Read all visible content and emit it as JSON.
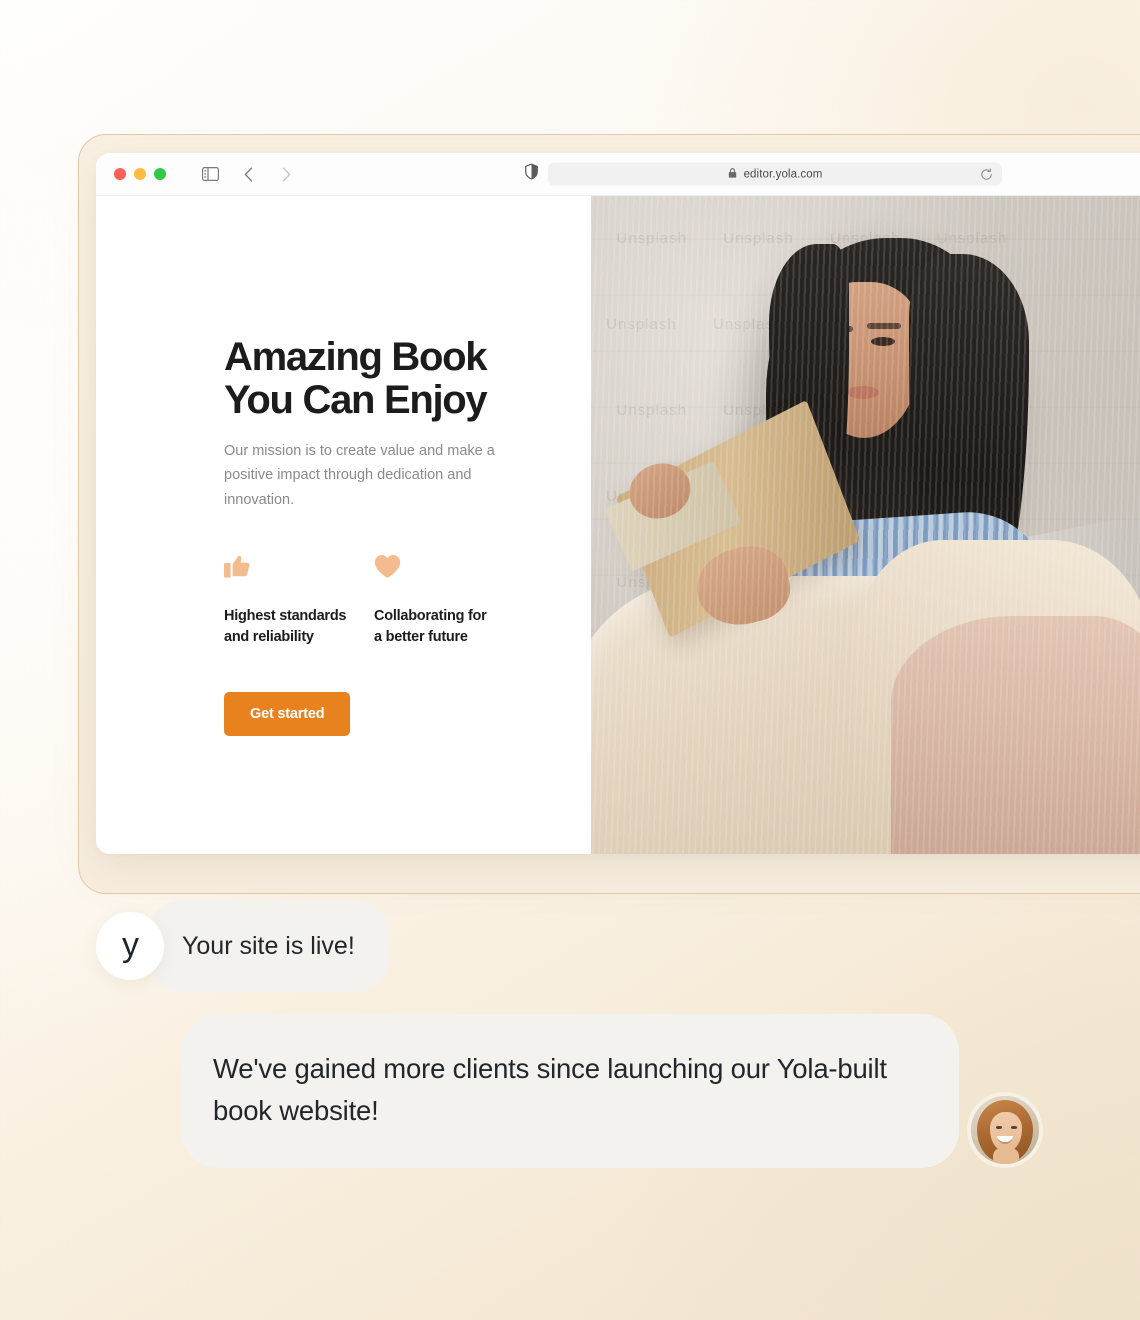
{
  "browser": {
    "traffic_lights": [
      "close",
      "minimize",
      "maximize"
    ],
    "sidebar_icon": "sidebar-toggle-icon",
    "back_icon": "chevron-left-icon",
    "forward_icon": "chevron-right-icon",
    "shield_icon": "shield-icon",
    "lock_icon": "lock-icon",
    "url": "editor.yola.com",
    "reload_icon": "reload-icon"
  },
  "site": {
    "headline": "Amazing Book\nYou Can Enjoy",
    "subcopy": "Our mission is to create value and make a positive impact through dedication and innovation.",
    "features": [
      {
        "icon": "thumbs-up-icon",
        "label": "Highest standards\nand reliability"
      },
      {
        "icon": "heart-icon",
        "label": "Collaborating for\na better future"
      }
    ],
    "cta_label": "Get started",
    "hero_image": "woman-reading-book-photo",
    "hero_watermark": "Unsplash"
  },
  "chat": {
    "messages": [
      {
        "avatar": "yola-logo-avatar",
        "avatar_glyph": "y",
        "text": "Your site is live!"
      },
      {
        "avatar": "user-photo-avatar",
        "text": "We've gained more clients since launching our Yola-built book website!"
      }
    ]
  },
  "colors": {
    "accent_orange": "#e8821e",
    "peach_icon": "#f2bc8f",
    "bubble_bg": "#f4f2ef",
    "frame_border": "#e3c9a4",
    "page_bg": "#f5efe4",
    "heading_text": "#1c1c1c",
    "body_text": "#8a8a8a"
  }
}
